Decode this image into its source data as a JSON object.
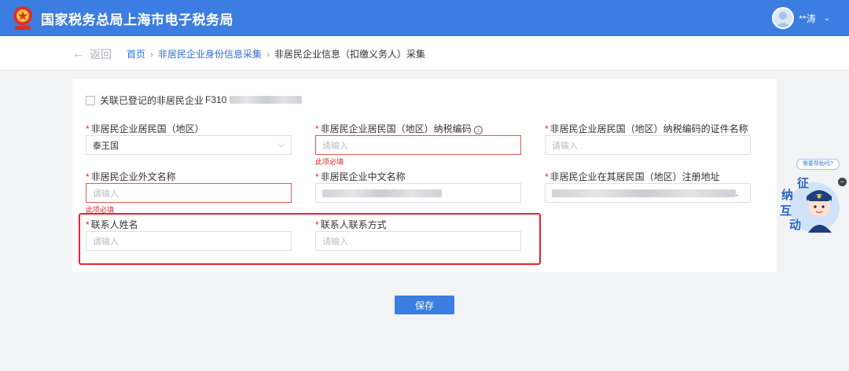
{
  "header": {
    "site_title": "国家税务总局上海市电子税务局",
    "user_name": "**涛",
    "brand_color": "#3b7de0"
  },
  "nav": {
    "back_label": "返回",
    "breadcrumb": {
      "home": "首页",
      "section": "非居民企业身份信息采集",
      "current": "非居民企业信息（扣缴义务人）采集"
    }
  },
  "form": {
    "associate_label": "关联已登记的非居民企业",
    "associate_code_prefix": "F310",
    "residence_country": {
      "label": "非居民企业居民国（地区）",
      "value": "泰王国"
    },
    "tax_id": {
      "label": "非居民企业居民国（地区）纳税编码",
      "placeholder": "请输入",
      "error": "此项必填"
    },
    "tax_id_doc_name": {
      "label": "非居民企业居民国（地区）纳税编码的证件名称",
      "placeholder": "请输入"
    },
    "foreign_name": {
      "label": "非居民企业外文名称",
      "placeholder": "请输入",
      "error": "此项必填"
    },
    "chinese_name": {
      "label": "非居民企业中文名称"
    },
    "registered_address": {
      "label": "非居民企业在其居民国（地区）注册地址",
      "trailing": "."
    },
    "contact_name": {
      "label": "联系人姓名",
      "placeholder": "请输入"
    },
    "contact_method": {
      "label": "联系人联系方式",
      "placeholder": "请输入"
    },
    "required_mark": "*",
    "save_label": "保存"
  },
  "assistant": {
    "bubble": "需要帮助吗?",
    "char1": "征",
    "char2": "纳",
    "char3": "互",
    "char4": "动"
  }
}
